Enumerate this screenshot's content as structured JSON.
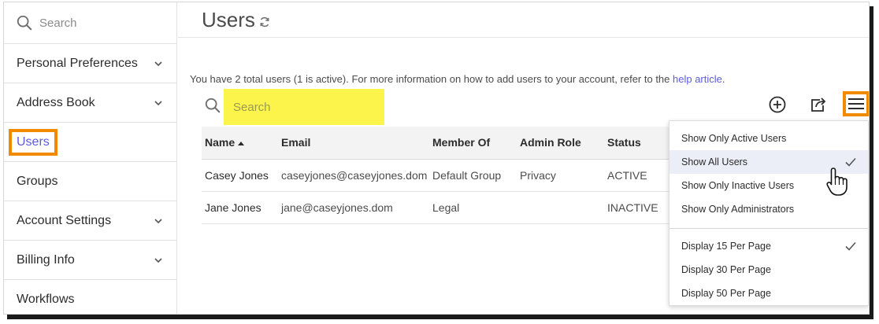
{
  "sidebar": {
    "search_placeholder": "Search",
    "items": [
      {
        "label": "Personal Preferences",
        "has_chevron": true
      },
      {
        "label": "Address Book",
        "has_chevron": true
      },
      {
        "label": "Users",
        "has_chevron": false,
        "active": true
      },
      {
        "label": "Groups",
        "has_chevron": false
      },
      {
        "label": "Account Settings",
        "has_chevron": true
      },
      {
        "label": "Billing Info",
        "has_chevron": true
      },
      {
        "label": "Workflows",
        "has_chevron": false
      }
    ]
  },
  "page": {
    "title": "Users",
    "info_text": "You have 2 total users (1 is active). For more information on how to add users to your account, refer to the ",
    "info_link": "help article",
    "info_end": "."
  },
  "table": {
    "search_placeholder": "Search",
    "columns": [
      "Name",
      "Email",
      "Member Of",
      "Admin Role",
      "Status"
    ],
    "rows": [
      {
        "name": "Casey Jones",
        "email": "caseyjones@caseyjones.dom",
        "member_of": "Default Group",
        "admin_role": "Privacy",
        "status": "ACTIVE"
      },
      {
        "name": "Jane Jones",
        "email": "jane@caseyjones.dom",
        "member_of": "Legal",
        "admin_role": "",
        "status": "INACTIVE"
      }
    ]
  },
  "menu": {
    "filter_items": [
      {
        "label": "Show Only Active Users",
        "checked": false
      },
      {
        "label": "Show All Users",
        "checked": true
      },
      {
        "label": "Show Only Inactive Users",
        "checked": false
      },
      {
        "label": "Show Only Administrators",
        "checked": false
      }
    ],
    "page_items": [
      {
        "label": "Display 15 Per Page",
        "checked": true
      },
      {
        "label": "Display 30 Per Page",
        "checked": false
      },
      {
        "label": "Display 50 Per Page",
        "checked": false
      }
    ]
  },
  "colors": {
    "accent": "#5c5ce0",
    "highlight_outline": "#f28a00",
    "search_highlight": "#fcf34b"
  }
}
